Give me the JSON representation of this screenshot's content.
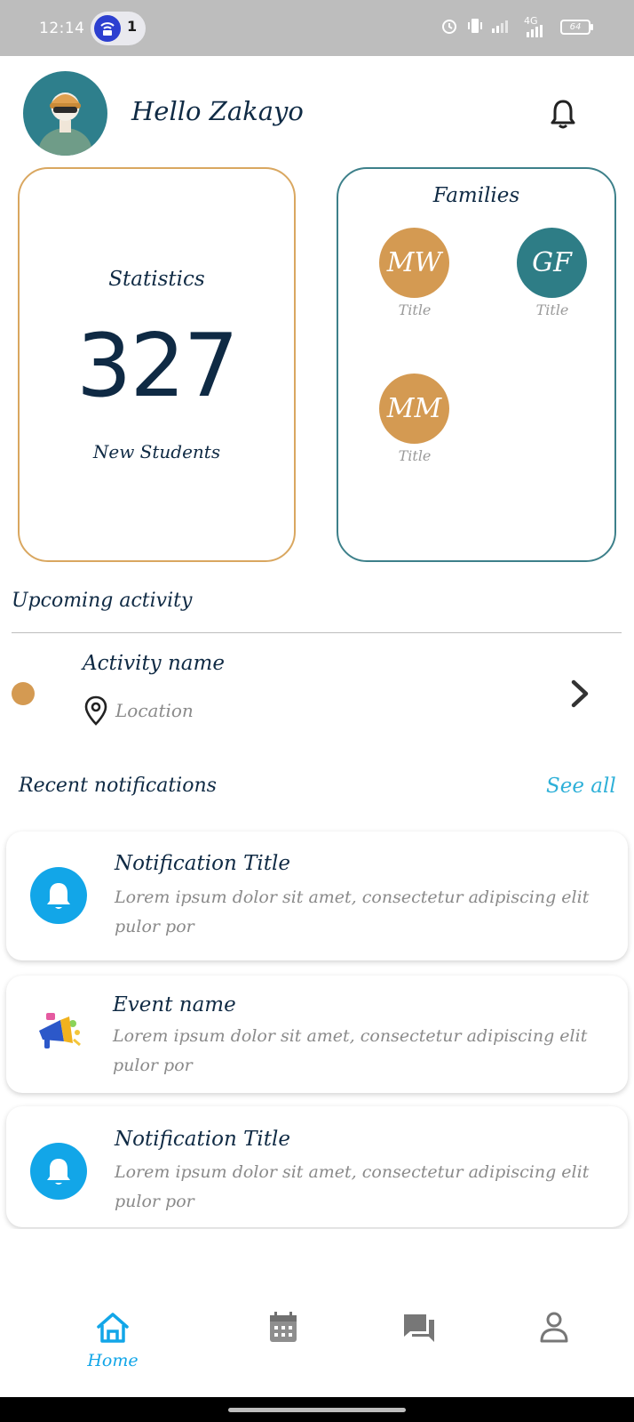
{
  "status_bar": {
    "time": "12:14",
    "notification_count": "1",
    "network_label": "4G",
    "battery": "64"
  },
  "header": {
    "greeting": "Hello Zakayo"
  },
  "statistics": {
    "label": "Statistics",
    "value": "327",
    "sublabel": "New Students"
  },
  "families": {
    "title": "Families",
    "items": [
      {
        "initials": "MW",
        "caption": "Title",
        "color": "#d49a52"
      },
      {
        "initials": "GF",
        "caption": "Title",
        "color": "#2e7d86"
      },
      {
        "initials": "MM",
        "caption": "Title",
        "color": "#d49a52"
      }
    ]
  },
  "upcoming": {
    "title": "Upcoming activity",
    "activity_name": "Activity name",
    "location": "Location"
  },
  "notifications": {
    "title": "Recent notifications",
    "see_all": "See all",
    "items": [
      {
        "icon": "bell-icon",
        "title": "Notification Title",
        "body": "Lorem ipsum dolor sit amet, consectetur adipiscing elit pulor por"
      },
      {
        "icon": "megaphone-icon",
        "title": "Event name",
        "body": "Lorem ipsum dolor sit amet, consectetur adipiscing elit pulor por"
      },
      {
        "icon": "bell-icon",
        "title": "Notification Title",
        "body": "Lorem ipsum dolor sit amet, consectetur adipiscing elit pulor por"
      }
    ]
  },
  "bottom_nav": {
    "items": [
      {
        "label": "Home",
        "icon": "home-icon",
        "active": true
      },
      {
        "label": "",
        "icon": "calendar-icon",
        "active": false
      },
      {
        "label": "",
        "icon": "chat-icon",
        "active": false
      },
      {
        "label": "",
        "icon": "profile-icon",
        "active": false
      }
    ]
  },
  "colors": {
    "accent": "#12a6e8",
    "stats_border": "#d9a760",
    "families_border": "#3d808a",
    "activity_dot": "#d49a52"
  }
}
